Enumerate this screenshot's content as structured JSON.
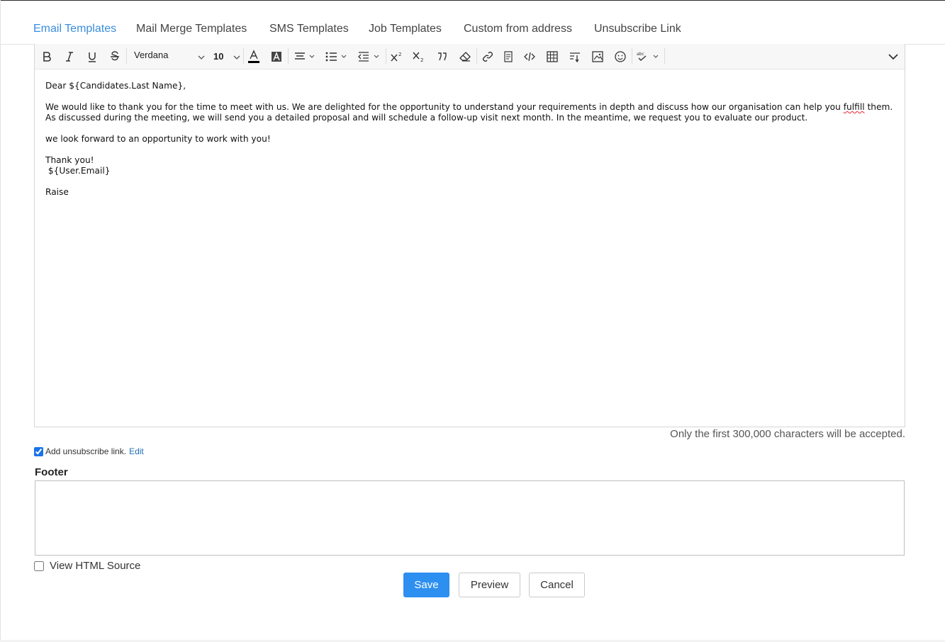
{
  "tabs": [
    {
      "label": "Email Templates",
      "active": true
    },
    {
      "label": "Mail Merge Templates",
      "active": false
    },
    {
      "label": "SMS Templates",
      "active": false
    },
    {
      "label": "Job Templates",
      "active": false
    },
    {
      "label": "Custom from address",
      "active": false
    },
    {
      "label": "Unsubscribe Link",
      "active": false
    }
  ],
  "toolbar": {
    "font_family": "Verdana",
    "font_size": "10",
    "text_color": "#000000",
    "icons": [
      "bold-icon",
      "italic-icon",
      "underline-icon",
      "strikethrough-icon",
      "font-color-icon",
      "background-color-icon",
      "align-icon",
      "bullet-list-icon",
      "indent-icon",
      "superscript-icon",
      "subscript-icon",
      "blockquote-icon",
      "clear-format-icon",
      "link-icon",
      "insert-template-icon",
      "code-icon",
      "table-icon",
      "format-painter-icon",
      "image-icon",
      "emoji-icon",
      "spellcheck-icon",
      "expand-chevron-icon"
    ]
  },
  "body": {
    "greeting": "Dear ${Candidates.Last Name},",
    "paragraph1_a": "We would like to thank you for the time to meet with us. We are delighted for the opportunity to understand your requirements in depth and discuss how our organisation can help you ",
    "paragraph1_misspelled": "fulfill",
    "paragraph1_b": " them. As discussed during the meeting, we will send you a detailed proposal and will schedule a follow-up visit next month. In the meantime, we request you to evaluate our product.",
    "paragraph2": "we look forward to an opportunity to work with you!",
    "thanks": "Thank you!",
    "signature": " ${User.Email}",
    "company": "Raise"
  },
  "char_limit_note": "Only the first 300,000 characters will be accepted.",
  "unsubscribe": {
    "checked": true,
    "label": "Add unsubscribe link.",
    "edit_label": "Edit"
  },
  "footer": {
    "label": "Footer",
    "value": ""
  },
  "view_html_source": {
    "checked": false,
    "label": "View HTML Source"
  },
  "buttons": {
    "save": "Save",
    "preview": "Preview",
    "cancel": "Cancel"
  },
  "colors": {
    "accent": "#2d8ff0",
    "tab_active": "#3a8ddd",
    "link": "#1f6fb5"
  }
}
